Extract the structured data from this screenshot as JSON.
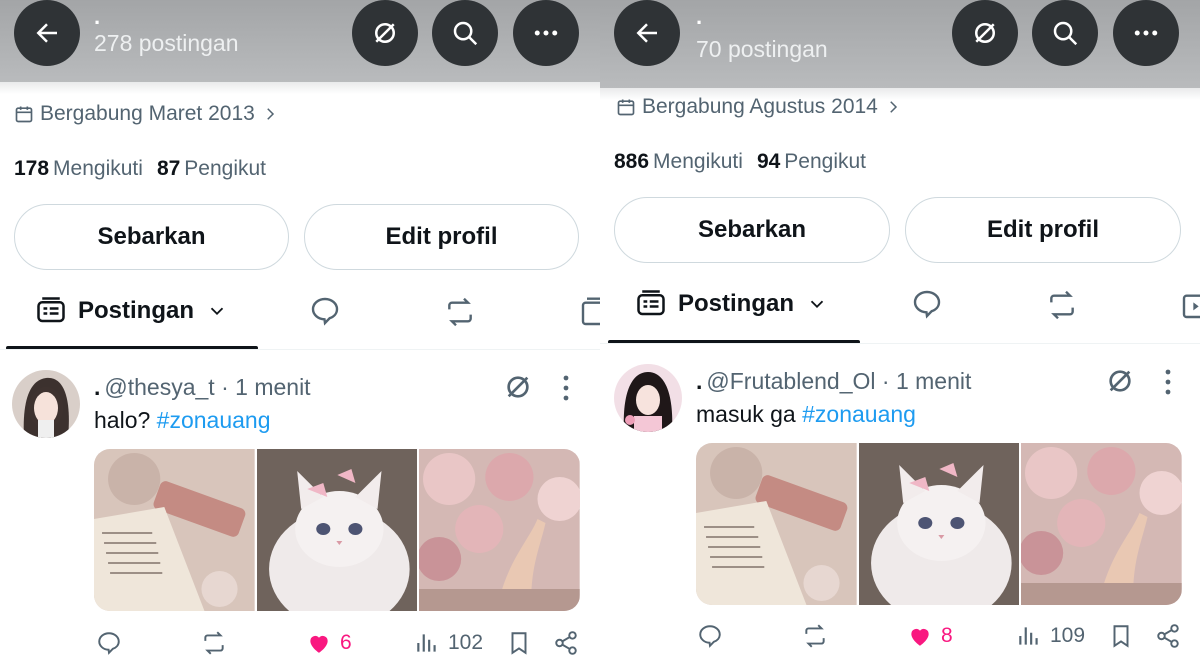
{
  "theme": {
    "accent": "#1d9bf0",
    "like": "#f91880",
    "text": "#0f1419",
    "muted": "#536471",
    "header_button": "#2f3336"
  },
  "panels": [
    {
      "header": {
        "name": ".",
        "post_count": "278 postingan",
        "buttons": [
          "back-icon",
          "nostr-icon",
          "search-icon",
          "more-icon"
        ]
      },
      "profile": {
        "joined": "Bergabung Maret 2013",
        "following_count": "178",
        "following_label": "Mengikuti",
        "followers_count": "87",
        "followers_label": "Pengikut"
      },
      "buttons": {
        "share": "Sebarkan",
        "edit": "Edit profil"
      },
      "tabs": {
        "active_label": "Postingan"
      },
      "post": {
        "display_name": ".",
        "handle": "@thesya_t",
        "separator": "·",
        "time": "1 menit",
        "text": "halo?",
        "hashtag": "#zonauang",
        "replies": "",
        "retweets": "",
        "likes": "6",
        "views": "102"
      }
    },
    {
      "header": {
        "name": ".",
        "post_count": "70 postingan",
        "buttons": [
          "back-icon",
          "nostr-icon",
          "search-icon",
          "more-icon"
        ]
      },
      "profile": {
        "joined": "Bergabung Agustus 2014",
        "following_count": "886",
        "following_label": "Mengikuti",
        "followers_count": "94",
        "followers_label": "Pengikut"
      },
      "buttons": {
        "share": "Sebarkan",
        "edit": "Edit profil"
      },
      "tabs": {
        "active_label": "Postingan"
      },
      "post": {
        "display_name": ".",
        "handle": "@Frutablend_Ol",
        "separator": "·",
        "time": "1 menit",
        "text": "masuk ga",
        "hashtag": "#zonauang",
        "replies": "",
        "retweets": "",
        "likes": "8",
        "views": "109"
      }
    }
  ]
}
